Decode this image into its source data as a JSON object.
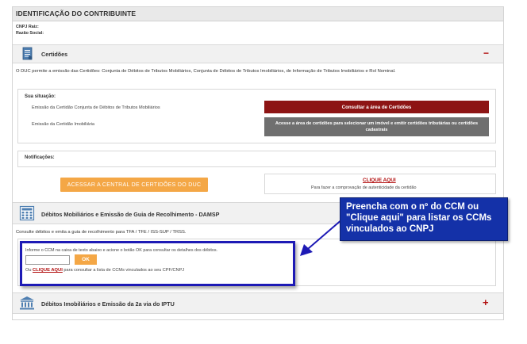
{
  "contribuinte": {
    "title": "IDENTIFICAÇÃO DO CONTRIBUINTE",
    "cnpj_label": "CNPJ Raiz:",
    "razao_label": "Razão Social:"
  },
  "certidoes": {
    "title": "Certidões",
    "toggle": "−",
    "description": "O DUC permite a emissão das Certidões: Conjunta de Débitos de Tributos Mobiliários, Conjunta de Débitos de Tributos Imobiliários, de Informação de Tributos Imobiliários e Rol Nominal.",
    "situacao_label": "Sua situação:",
    "item1_label": "Emissão da Certidão Conjunta de Débitos de Tributos Mobiliários",
    "item1_button": "Consultar a área de Certidões",
    "item2_label": "Emissão da Certidão Imobiliária",
    "item2_button": "Acesse a área de certidões para selecionar um imóvel e emitir certidões tributárias ou certidões cadastrais",
    "notificacoes_label": "Notificações:",
    "central_button": "ACESSAR A CENTRAL DE CERTIDÕES DO DUC",
    "clique_aqui": "CLIQUE AQUI",
    "autenticidade": "Para fazer a comprovação de autenticidade da certidão"
  },
  "debitos_mob": {
    "title": "Débitos Mobiliários e Emissão de Guia de Recolhimento - DAMSP",
    "description": "Consulte débitos e emita a guia de recolhimento para TFA / TFE / ISS-SUP / TRSS.",
    "instruction": "Informe o CCM na caixa de texto abaixo e acione o botão OK para consultar os detalhes dos débitos.",
    "ccm_value": "",
    "ok_label": "OK",
    "ou_prefix": "Ou ",
    "clique_aqui": "CLIQUE AQUI",
    "ou_suffix": " para consultar a lista de CCMs vinculados ao seu CPF/CNPJ"
  },
  "debitos_imob": {
    "title": "Débitos Imobiliários e Emissão da 2a via do IPTU",
    "toggle": "+"
  },
  "callout": {
    "text": "Preencha com o nº do CCM  ou \"Clique aqui\" para listar os CCMs vinculados ao CNPJ"
  },
  "colors": {
    "red_button": "#8d1414",
    "gray_button": "#6f6f6f",
    "orange_button": "#f4a746",
    "callout_blue": "#1431a8",
    "highlight_border": "#1d1ab5"
  }
}
